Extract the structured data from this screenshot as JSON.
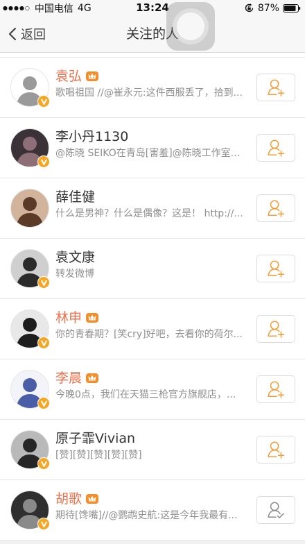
{
  "status_bar": {
    "signal": "●●●●○",
    "carrier": "中国电信",
    "network": "4G",
    "time": "13:24",
    "battery": "87%"
  },
  "nav": {
    "back_label": "返回",
    "title": "关注的人"
  },
  "colors": {
    "status_text": "#8f8f8f",
    "follow_icon_color": "#f29c38",
    "followed_icon_color": "#8a8a8a",
    "verified_badge": "#f5a623",
    "vip_badge": "#f08f2c",
    "bar_bg": "#f7f7f7"
  },
  "users": [
    {
      "name": "袁弘",
      "name_color": "#eb7350",
      "vip": true,
      "verified": true,
      "status": "歌唱祖国 //@崔永元:这件西服丢了，拾到...",
      "follow_icon": "add-user-icon",
      "avatar_bg": "#ffffff",
      "avatar_fg": "#9a9a9a"
    },
    {
      "name": "李小丹1130",
      "name_color": "#333333",
      "vip": false,
      "verified": true,
      "status": "@陈晓 SEIKO在青岛[害羞]@陈晓工作室...",
      "follow_icon": "add-user-icon",
      "avatar_bg": "#3a3236",
      "avatar_fg": "#8e6f78"
    },
    {
      "name": "薛佳健",
      "name_color": "#333333",
      "vip": false,
      "verified": false,
      "status": "什么是男神？什么是偶像？这是！ http://...",
      "follow_icon": "add-user-icon",
      "avatar_bg": "#d2b49c",
      "avatar_fg": "#5b3a28"
    },
    {
      "name": "袁文康",
      "name_color": "#333333",
      "vip": false,
      "verified": true,
      "status": "转发微博",
      "follow_icon": "add-user-icon",
      "avatar_bg": "#cfcfcf",
      "avatar_fg": "#2b2b2b"
    },
    {
      "name": "林申",
      "name_color": "#eb7350",
      "vip": true,
      "verified": true,
      "status": "你的青春期？[笑cry]好吧，去看你的荷尔...",
      "follow_icon": "add-user-icon",
      "avatar_bg": "#e8e8e8",
      "avatar_fg": "#1e1e1e"
    },
    {
      "name": "李晨",
      "name_color": "#eb7350",
      "vip": true,
      "verified": true,
      "status": "今晚0点，我们在天猫三枪官方旗舰店，...",
      "follow_icon": "add-user-icon",
      "avatar_bg": "#f3f4f9",
      "avatar_fg": "#4a5ea8"
    },
    {
      "name": "原子霏Vivian",
      "name_color": "#333333",
      "vip": false,
      "verified": true,
      "status": "[赞][赞][赞][赞][赞]",
      "follow_icon": "add-user-icon",
      "avatar_bg": "#b9b9b9",
      "avatar_fg": "#262626"
    },
    {
      "name": "胡歌",
      "name_color": "#eb7350",
      "vip": true,
      "verified": true,
      "status": "期待[馋嘴]//@鹦鹉史航:这是今年我最有...",
      "follow_icon": "user-check-icon",
      "avatar_bg": "#2f2f2f",
      "avatar_fg": "#8a8a8a"
    }
  ]
}
